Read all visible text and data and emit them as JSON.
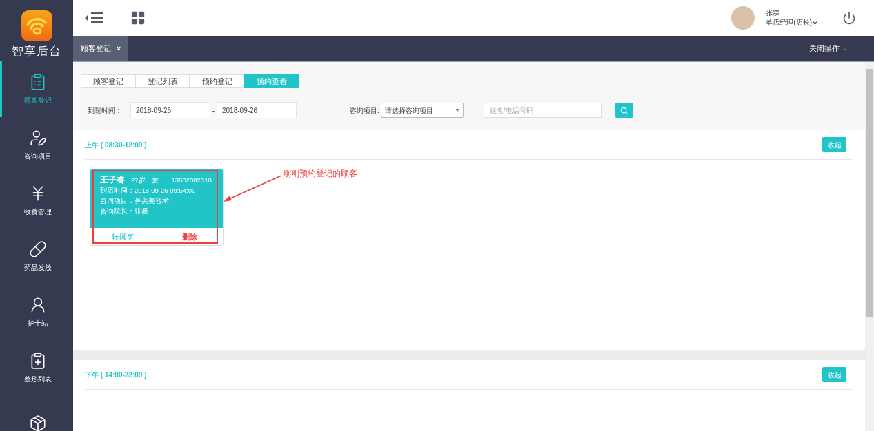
{
  "brand": {
    "name": "智享后台"
  },
  "sidebar": {
    "items": [
      {
        "label": "顾客登记",
        "kind": "list",
        "selected": true
      },
      {
        "label": "咨询项目",
        "kind": "consult",
        "selected": false
      },
      {
        "label": "收费管理",
        "kind": "billing",
        "selected": false
      },
      {
        "label": "药品发放",
        "kind": "medicine",
        "selected": false
      },
      {
        "label": "护士站",
        "kind": "nurse",
        "selected": false
      },
      {
        "label": "整形列表",
        "kind": "surgery",
        "selected": false
      },
      {
        "kind": "stock",
        "selected": false
      }
    ]
  },
  "user": {
    "name": "张霖",
    "role": "单店经理(店长)"
  },
  "page_tabs": [
    {
      "label": "顾客登记",
      "close": "×",
      "selected": true
    }
  ],
  "close_menu": "关闭操作",
  "sub_tabs": [
    {
      "label": "顾客登记",
      "selected": false
    },
    {
      "label": "登记列表",
      "selected": false
    },
    {
      "label": "预约登记",
      "selected": false
    },
    {
      "label": "预约查看",
      "selected": true
    }
  ],
  "filters": {
    "date_label": "到院时间：",
    "date_from": "2018-09-26",
    "date_sep": "-",
    "date_to": "2018-09-26",
    "project_label": "咨询项目:",
    "project_placeholder": "请选择咨询项目",
    "search_placeholder": "姓名/电话号码"
  },
  "sections": [
    {
      "title": "上午 ( 08:30-12:00 )",
      "collapse": "收起",
      "cards": [
        {
          "name": "王子睿",
          "age": "27岁",
          "gender": "女",
          "phone": "13502302310",
          "lines": [
            "到店时间：2018-09-26 09:54:00",
            "咨询项目：鼻尖美容术",
            "咨询院长：张霎"
          ],
          "actions": [
            "转顾客",
            "删除"
          ],
          "highlighted": true
        }
      ]
    },
    {
      "title": "下午 ( 14:00-22:00 )",
      "collapse": "收起"
    }
  ],
  "annotation": "刚刚预约登记的顾客"
}
